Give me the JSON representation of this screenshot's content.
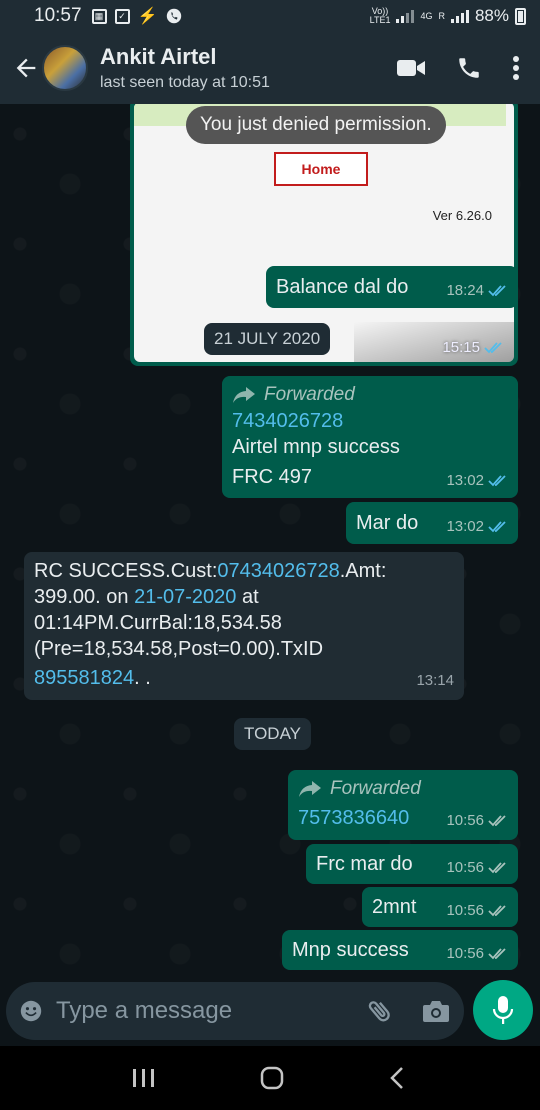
{
  "status_bar": {
    "time": "10:57",
    "volte": "Vo))",
    "lte": "LTE1",
    "net": "4G",
    "roaming": "R",
    "battery": "88%"
  },
  "header": {
    "contact_name": "Ankit Airtel",
    "last_seen": "last seen today at 10:51"
  },
  "image_message": {
    "toast": "You just denied permission.",
    "home_button": "Home",
    "version": "Ver 6.26.0",
    "time": "15:15"
  },
  "messages": [
    {
      "text": "Balance dal do",
      "time": "18:24"
    },
    {
      "forwarded_label": "Forwarded",
      "number": "7434026728",
      "line1": "Airtel mnp success",
      "line2": "FRC 497",
      "time": "13:02"
    },
    {
      "text": "Mar do",
      "time": "13:02"
    },
    {
      "p1": "RC SUCCESS.Cust:",
      "l1": "07434026728",
      "p2": ".Amt:",
      "p3": "399.00. on ",
      "l2": "21-07-2020",
      "p4": " at",
      "p5": "01:14PM.CurrBal:18,534.58",
      "p6": "(Pre=18,534.58,Post=0.00).TxID",
      "l3": "895581824",
      "p7": ". .",
      "time": "13:14"
    },
    {
      "forwarded_label": "Forwarded",
      "number": "7573836640",
      "time": "10:56"
    },
    {
      "text": "Frc mar do",
      "time": "10:56"
    },
    {
      "text": "2mnt",
      "time": "10:56"
    },
    {
      "text": "Mnp success",
      "time": "10:56"
    }
  ],
  "dates": {
    "first": "21 JULY 2020",
    "second": "TODAY"
  },
  "composer": {
    "placeholder": "Type a message"
  },
  "colors": {
    "outgoing": "#005c4b",
    "incoming": "#202c33",
    "accent": "#00a884",
    "link": "#53bdeb",
    "read_tick": "#53bdeb"
  }
}
